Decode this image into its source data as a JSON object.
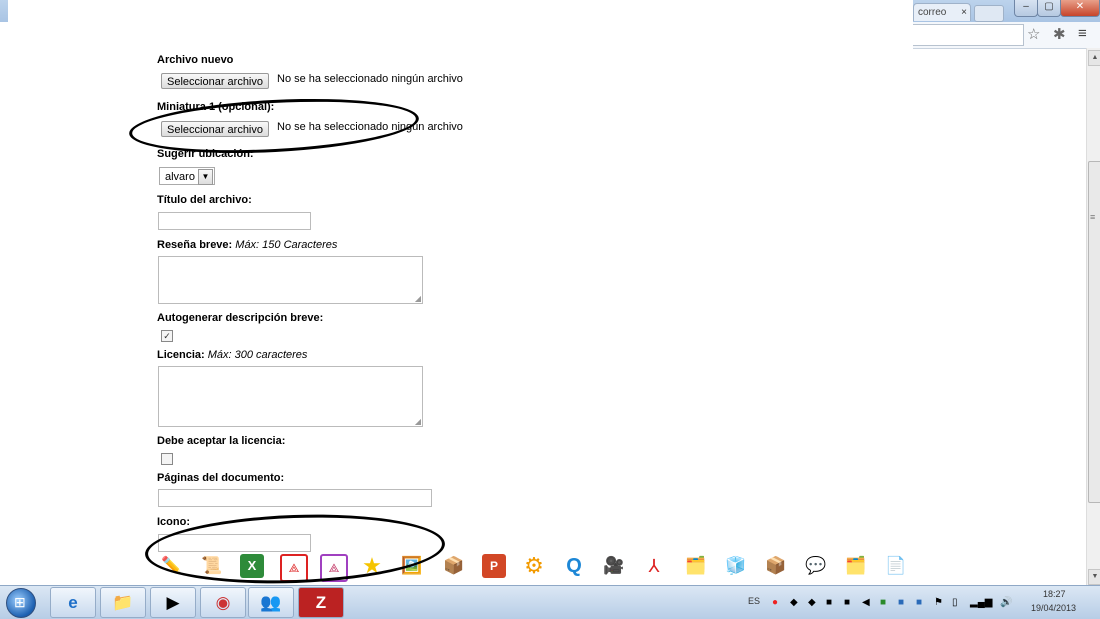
{
  "browser": {
    "tab_label": "correo",
    "tab_close": "×",
    "window": {
      "minimize": "‒",
      "maximize": "▢",
      "close": "✕"
    },
    "toolbar_icons": [
      "star-icon",
      "extension-icon",
      "menu-icon"
    ]
  },
  "form": {
    "archivo_nuevo": {
      "label": "Archivo nuevo",
      "button": "Seleccionar archivo",
      "note": "No se ha seleccionado ningún archivo"
    },
    "miniatura": {
      "label": "Miniatura 1 (opcional):",
      "button": "Seleccionar archivo",
      "note": "No se ha seleccionado ningún archivo"
    },
    "ubicacion": {
      "label": "Sugerir ubicación:",
      "selected": "alvaro"
    },
    "titulo": {
      "label": "Título del archivo:",
      "value": ""
    },
    "resena": {
      "label": "Reseña breve:",
      "hint": "Máx: 150 Caracteres",
      "value": ""
    },
    "autogenerar": {
      "label": "Autogenerar descripción breve:",
      "checked": true
    },
    "licencia": {
      "label": "Licencia:",
      "hint": "Máx: 300 caracteres",
      "value": ""
    },
    "aceptar": {
      "label": "Debe aceptar la licencia:",
      "checked": false
    },
    "paginas": {
      "label": "Páginas del documento:",
      "value": ""
    },
    "icono": {
      "label": "Icono:",
      "value": ""
    }
  },
  "icon_options": [
    "pencil-icon",
    "scroll-icon",
    "excel-icon",
    "pdf-icon",
    "pdf-purple-icon",
    "star-icon",
    "image-icon",
    "package-icon",
    "powerpoint-icon",
    "gear-icon",
    "quicktime-icon",
    "camera-icon",
    "acrobat-icon",
    "folder-icon",
    "cube-icon",
    "box-icon",
    "chat-icon",
    "folder-docs-icon",
    "document-icon"
  ],
  "taskbar": {
    "apps": [
      "ie-icon",
      "explorer-icon",
      "media-player-icon",
      "chrome-icon",
      "live-icon",
      "filezilla-icon"
    ],
    "language": "ES",
    "time": "18:27",
    "date": "19/04/2013"
  },
  "colors": {
    "annotation": "#000000",
    "taskbar": "#c6d8ec"
  }
}
